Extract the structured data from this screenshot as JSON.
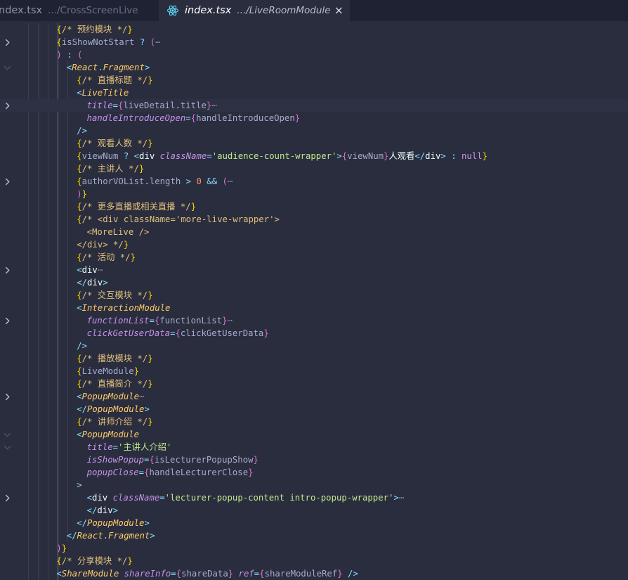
{
  "tabs": [
    {
      "name": "index.tsx",
      "path": ".../CrossScreenLive",
      "active": false
    },
    {
      "name": "index.tsx",
      "path": ".../LiveRoomModule",
      "active": true,
      "close": "×"
    }
  ],
  "icons": {
    "react": "react-logo-icon",
    "close": "close-icon",
    "fold_closed": "chevron-right-icon",
    "fold_open": "chevron-down-icon"
  },
  "colors": {
    "background": "#292d3e",
    "tabbar": "#1f2233",
    "comment": "#e4c07a",
    "string": "#c3e88d",
    "attribute": "#c792ea",
    "component": "#ffcb6b",
    "punctuation": "#89ddff"
  },
  "lines": [
    {
      "fold": "",
      "indent": 4,
      "tokens": [
        [
          "{",
          "t-brace"
        ],
        [
          "/* 预约模块 */",
          "t-comment"
        ],
        [
          "}",
          "t-brace"
        ]
      ]
    },
    {
      "fold": "closed",
      "indent": 4,
      "tokens": [
        [
          "{",
          "t-brace"
        ],
        [
          "isShowNotStart",
          "t-var"
        ],
        [
          " ? ",
          "t-op"
        ],
        [
          "(",
          "t-brace2"
        ],
        [
          "⋯",
          "t-ell"
        ]
      ]
    },
    {
      "fold": "",
      "indent": 4,
      "tokens": [
        [
          ")",
          "t-brace2"
        ],
        [
          " : ",
          "t-op"
        ],
        [
          "(",
          "t-brace2"
        ]
      ]
    },
    {
      "fold": "open",
      "indent": 5,
      "tokens": [
        [
          "<",
          "t-punct"
        ],
        [
          "React",
          "t-comp"
        ],
        [
          ".",
          "t-punct"
        ],
        [
          "Fragment",
          "t-comp"
        ],
        [
          ">",
          "t-punct"
        ]
      ]
    },
    {
      "fold": "",
      "indent": 6,
      "tokens": [
        [
          "{",
          "t-brace"
        ],
        [
          "/* 直播标题 */",
          "t-comment"
        ],
        [
          "}",
          "t-brace"
        ]
      ]
    },
    {
      "fold": "",
      "indent": 6,
      "tokens": [
        [
          "<",
          "t-punct"
        ],
        [
          "LiveTitle",
          "t-comp"
        ]
      ]
    },
    {
      "fold": "closed",
      "indent": 7,
      "hl": true,
      "tokens": [
        [
          "title",
          "t-attr"
        ],
        [
          "=",
          "t-punct"
        ],
        [
          "{",
          "t-brace2"
        ],
        [
          "liveDetail",
          "t-var"
        ],
        [
          ".",
          "t-punct"
        ],
        [
          "title",
          "t-var"
        ],
        [
          "}",
          "t-brace2"
        ],
        [
          "⋯",
          "t-ell"
        ]
      ]
    },
    {
      "fold": "",
      "indent": 7,
      "tokens": [
        [
          "handleIntroduceOpen",
          "t-attr"
        ],
        [
          "=",
          "t-punct"
        ],
        [
          "{",
          "t-brace2"
        ],
        [
          "handleIntroduceOpen",
          "t-var"
        ],
        [
          "}",
          "t-brace2"
        ]
      ]
    },
    {
      "fold": "",
      "indent": 6,
      "tokens": [
        [
          "/>",
          "t-punct"
        ]
      ]
    },
    {
      "fold": "",
      "indent": 6,
      "tokens": [
        [
          "{",
          "t-brace"
        ],
        [
          "/* 观看人数 */",
          "t-comment"
        ],
        [
          "}",
          "t-brace"
        ]
      ]
    },
    {
      "fold": "",
      "indent": 6,
      "tokens": [
        [
          "{",
          "t-brace"
        ],
        [
          "viewNum",
          "t-var"
        ],
        [
          " ? ",
          "t-op"
        ],
        [
          "<",
          "t-punct"
        ],
        [
          "div",
          "t-tag"
        ],
        [
          " ",
          "t-plain"
        ],
        [
          "className",
          "t-attr"
        ],
        [
          "=",
          "t-punct"
        ],
        [
          "'audience-count-wrapper'",
          "t-str"
        ],
        [
          ">",
          "t-punct"
        ],
        [
          "{",
          "t-brace2"
        ],
        [
          "viewNum",
          "t-var"
        ],
        [
          "}",
          "t-brace2"
        ],
        [
          "人观看",
          "t-text"
        ],
        [
          "</",
          "t-punct"
        ],
        [
          "div",
          "t-tag"
        ],
        [
          ">",
          "t-punct"
        ],
        [
          " : ",
          "t-op"
        ],
        [
          "null",
          "t-kw"
        ],
        [
          "}",
          "t-brace"
        ]
      ]
    },
    {
      "fold": "",
      "indent": 6,
      "tokens": [
        [
          "{",
          "t-brace"
        ],
        [
          "/* 主讲人 */",
          "t-comment"
        ],
        [
          "}",
          "t-brace"
        ]
      ]
    },
    {
      "fold": "closed",
      "indent": 6,
      "tokens": [
        [
          "{",
          "t-brace"
        ],
        [
          "authorVOList",
          "t-var"
        ],
        [
          ".",
          "t-punct"
        ],
        [
          "length",
          "t-var"
        ],
        [
          " > ",
          "t-op"
        ],
        [
          "0",
          "t-num"
        ],
        [
          " && ",
          "t-op"
        ],
        [
          "(",
          "t-brace2"
        ],
        [
          "⋯",
          "t-ell"
        ]
      ]
    },
    {
      "fold": "",
      "indent": 6,
      "tokens": [
        [
          ")",
          "t-brace2"
        ],
        [
          "}",
          "t-brace"
        ]
      ]
    },
    {
      "fold": "",
      "indent": 6,
      "tokens": [
        [
          "{",
          "t-brace"
        ],
        [
          "/* 更多直播或相关直播 */",
          "t-comment"
        ],
        [
          "}",
          "t-brace"
        ]
      ]
    },
    {
      "fold": "",
      "indent": 6,
      "tokens": [
        [
          "{",
          "t-brace"
        ],
        [
          "/* <div className='more-live-wrapper'>",
          "t-comment"
        ]
      ]
    },
    {
      "fold": "",
      "indent": 7,
      "tokens": [
        [
          "<MoreLive />",
          "t-comment"
        ]
      ]
    },
    {
      "fold": "",
      "indent": 6,
      "tokens": [
        [
          "</div> */",
          "t-comment"
        ],
        [
          "}",
          "t-brace"
        ]
      ]
    },
    {
      "fold": "",
      "indent": 6,
      "tokens": [
        [
          "{",
          "t-brace"
        ],
        [
          "/* 活动 */",
          "t-comment"
        ],
        [
          "}",
          "t-brace"
        ]
      ]
    },
    {
      "fold": "closed",
      "indent": 6,
      "tokens": [
        [
          "<",
          "t-punct"
        ],
        [
          "div",
          "t-tag"
        ],
        [
          "⋯",
          "t-ell"
        ]
      ]
    },
    {
      "fold": "",
      "indent": 6,
      "tokens": [
        [
          "</",
          "t-punct"
        ],
        [
          "div",
          "t-tag"
        ],
        [
          ">",
          "t-punct"
        ]
      ]
    },
    {
      "fold": "",
      "indent": 6,
      "tokens": [
        [
          "{",
          "t-brace"
        ],
        [
          "/* 交互模块 */",
          "t-comment"
        ],
        [
          "}",
          "t-brace"
        ]
      ]
    },
    {
      "fold": "",
      "indent": 6,
      "tokens": [
        [
          "<",
          "t-punct"
        ],
        [
          "InteractionModule",
          "t-comp"
        ]
      ]
    },
    {
      "fold": "closed",
      "indent": 7,
      "tokens": [
        [
          "functionList",
          "t-attr"
        ],
        [
          "=",
          "t-punct"
        ],
        [
          "{",
          "t-brace2"
        ],
        [
          "functionList",
          "t-var"
        ],
        [
          "}",
          "t-brace2"
        ],
        [
          "⋯",
          "t-ell"
        ]
      ]
    },
    {
      "fold": "",
      "indent": 7,
      "tokens": [
        [
          "clickGetUserData",
          "t-attr"
        ],
        [
          "=",
          "t-punct"
        ],
        [
          "{",
          "t-brace2"
        ],
        [
          "clickGetUserData",
          "t-var"
        ],
        [
          "}",
          "t-brace2"
        ]
      ]
    },
    {
      "fold": "",
      "indent": 6,
      "tokens": [
        [
          "/>",
          "t-punct"
        ]
      ]
    },
    {
      "fold": "",
      "indent": 6,
      "tokens": [
        [
          "{",
          "t-brace"
        ],
        [
          "/* 播放模块 */",
          "t-comment"
        ],
        [
          "}",
          "t-brace"
        ]
      ]
    },
    {
      "fold": "",
      "indent": 6,
      "tokens": [
        [
          "{",
          "t-brace"
        ],
        [
          "LiveModule",
          "t-var"
        ],
        [
          "}",
          "t-brace"
        ]
      ]
    },
    {
      "fold": "",
      "indent": 6,
      "tokens": [
        [
          "{",
          "t-brace"
        ],
        [
          "/* 直播简介 */",
          "t-comment"
        ],
        [
          "}",
          "t-brace"
        ]
      ]
    },
    {
      "fold": "closed",
      "indent": 6,
      "tokens": [
        [
          "<",
          "t-punct"
        ],
        [
          "PopupModule",
          "t-comp"
        ],
        [
          "⋯",
          "t-ell"
        ]
      ]
    },
    {
      "fold": "",
      "indent": 6,
      "tokens": [
        [
          "</",
          "t-punct"
        ],
        [
          "PopupModule",
          "t-comp"
        ],
        [
          ">",
          "t-punct"
        ]
      ]
    },
    {
      "fold": "",
      "indent": 6,
      "tokens": [
        [
          "{",
          "t-brace"
        ],
        [
          "/* 讲师介绍 */",
          "t-comment"
        ],
        [
          "}",
          "t-brace"
        ]
      ]
    },
    {
      "fold": "open",
      "indent": 6,
      "tokens": [
        [
          "<",
          "t-punct"
        ],
        [
          "PopupModule",
          "t-comp"
        ]
      ]
    },
    {
      "fold": "open",
      "indent": 7,
      "tokens": [
        [
          "title",
          "t-attr"
        ],
        [
          "=",
          "t-punct"
        ],
        [
          "'主讲人介绍'",
          "t-str"
        ]
      ]
    },
    {
      "fold": "",
      "indent": 7,
      "tokens": [
        [
          "isShowPopup",
          "t-attr"
        ],
        [
          "=",
          "t-punct"
        ],
        [
          "{",
          "t-brace2"
        ],
        [
          "isLecturerPopupShow",
          "t-var"
        ],
        [
          "}",
          "t-brace2"
        ]
      ]
    },
    {
      "fold": "",
      "indent": 7,
      "tokens": [
        [
          "popupClose",
          "t-attr"
        ],
        [
          "=",
          "t-punct"
        ],
        [
          "{",
          "t-brace2"
        ],
        [
          "handleLecturerClose",
          "t-var"
        ],
        [
          "}",
          "t-brace2"
        ]
      ]
    },
    {
      "fold": "",
      "indent": 6,
      "tokens": [
        [
          ">",
          "t-punct"
        ]
      ]
    },
    {
      "fold": "closed",
      "indent": 7,
      "tokens": [
        [
          "<",
          "t-punct"
        ],
        [
          "div",
          "t-tag"
        ],
        [
          " ",
          "t-plain"
        ],
        [
          "className",
          "t-attr"
        ],
        [
          "=",
          "t-punct"
        ],
        [
          "'lecturer-popup-content intro-popup-wrapper'",
          "t-str"
        ],
        [
          ">",
          "t-punct"
        ],
        [
          "⋯",
          "t-ell"
        ]
      ]
    },
    {
      "fold": "",
      "indent": 7,
      "tokens": [
        [
          "</",
          "t-punct"
        ],
        [
          "div",
          "t-tag"
        ],
        [
          ">",
          "t-punct"
        ]
      ]
    },
    {
      "fold": "",
      "indent": 6,
      "tokens": [
        [
          "</",
          "t-punct"
        ],
        [
          "PopupModule",
          "t-comp"
        ],
        [
          ">",
          "t-punct"
        ]
      ]
    },
    {
      "fold": "",
      "indent": 5,
      "tokens": [
        [
          "</",
          "t-punct"
        ],
        [
          "React",
          "t-comp"
        ],
        [
          ".",
          "t-punct"
        ],
        [
          "Fragment",
          "t-comp"
        ],
        [
          ">",
          "t-punct"
        ]
      ]
    },
    {
      "fold": "",
      "indent": 4,
      "tokens": [
        [
          ")",
          "t-brace2"
        ],
        [
          "}",
          "t-brace"
        ]
      ]
    },
    {
      "fold": "",
      "indent": 4,
      "tokens": [
        [
          "{",
          "t-brace"
        ],
        [
          "/* 分享模块 */",
          "t-comment"
        ],
        [
          "}",
          "t-brace"
        ]
      ]
    },
    {
      "fold": "",
      "indent": 4,
      "tokens": [
        [
          "<",
          "t-punct"
        ],
        [
          "ShareModule",
          "t-comp"
        ],
        [
          " ",
          "t-plain"
        ],
        [
          "shareInfo",
          "t-attr"
        ],
        [
          "=",
          "t-punct"
        ],
        [
          "{",
          "t-brace2"
        ],
        [
          "shareData",
          "t-var"
        ],
        [
          "}",
          "t-brace2"
        ],
        [
          " ",
          "t-plain"
        ],
        [
          "ref",
          "t-attr"
        ],
        [
          "=",
          "t-punct"
        ],
        [
          "{",
          "t-brace2"
        ],
        [
          "shareModuleRef",
          "t-var"
        ],
        [
          "}",
          "t-brace2"
        ],
        [
          " />",
          "t-punct"
        ]
      ]
    }
  ]
}
